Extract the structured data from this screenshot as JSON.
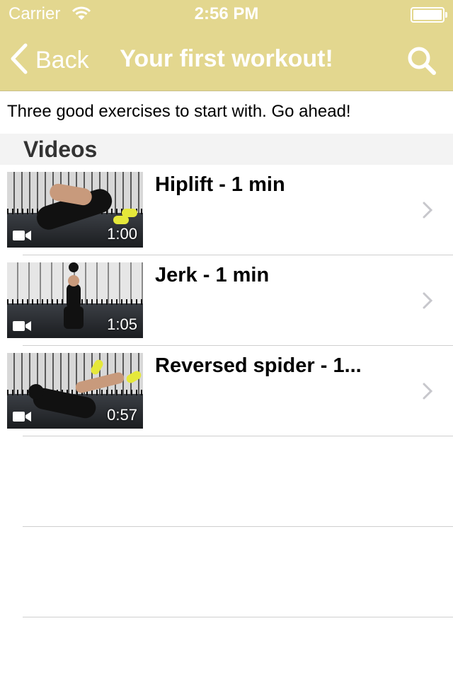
{
  "status_bar": {
    "carrier": "Carrier",
    "time": "2:56 PM"
  },
  "nav": {
    "back_label": "Back",
    "title": "Your first workout!",
    "back_icon": "chevron-left-icon",
    "search_icon": "search-icon"
  },
  "intro": "Three good exercises to start with. Go ahead!",
  "section": {
    "title": "Videos"
  },
  "videos": [
    {
      "title": "Hiplift - 1 min",
      "duration": "1:00"
    },
    {
      "title": "Jerk - 1 min",
      "duration": "1:05"
    },
    {
      "title": "Reversed spider - 1...",
      "duration": "0:57"
    }
  ],
  "colors": {
    "nav_background": "#e3d78f",
    "nav_text": "#ffffff",
    "section_background": "#f3f3f3",
    "chevron": "#c7c7cc"
  }
}
